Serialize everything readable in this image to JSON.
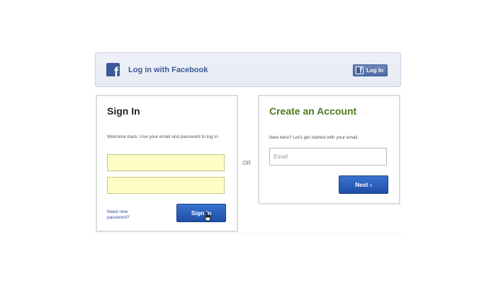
{
  "facebook_bar": {
    "logo_letter": "f",
    "label": "Log in with Facebook",
    "button_label": "Log In",
    "brand_color": "#3b5a99"
  },
  "sign_in": {
    "title": "Sign In",
    "intro": "Welcome back. Use your email and password to log in.",
    "email_value": "",
    "password_value": "",
    "forgot_link": "Need new password?",
    "button_label": "Sign In",
    "input_color": "#fdfdc5"
  },
  "separator": {
    "label": "OR"
  },
  "create_account": {
    "title": "Create an Account",
    "title_color": "#4a7a1c",
    "intro": "New here? Let's get started with your email.",
    "email_placeholder": "Email",
    "button_label": "Next ›"
  },
  "button_color": "#2a5fbd",
  "icons": [
    "facebook-icon",
    "mouse-cursor-icon"
  ]
}
